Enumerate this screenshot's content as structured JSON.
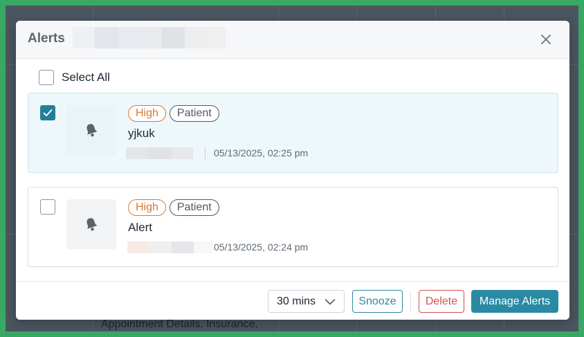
{
  "backdrop": {
    "partial_text": "Appointment Details, Insurance,"
  },
  "modal": {
    "title": "Alerts",
    "select_all_label": "Select All",
    "alerts": [
      {
        "selected": true,
        "priority": "High",
        "type": "Patient",
        "title": "yjkuk",
        "datetime": "05/13/2025, 02:25 pm",
        "icon": "bell-icon"
      },
      {
        "selected": false,
        "priority": "High",
        "type": "Patient",
        "title": "Alert",
        "datetime": "05/13/2025, 02:24 pm",
        "icon": "bell-icon"
      }
    ],
    "footer": {
      "snooze_duration": "30 mins",
      "snooze_label": "Snooze",
      "delete_label": "Delete",
      "manage_label": "Manage Alerts"
    }
  },
  "colors": {
    "frame": "#3aa865",
    "accent": "#2b8aa3",
    "priority_high": "#d8782f",
    "delete": "#d0524f"
  }
}
